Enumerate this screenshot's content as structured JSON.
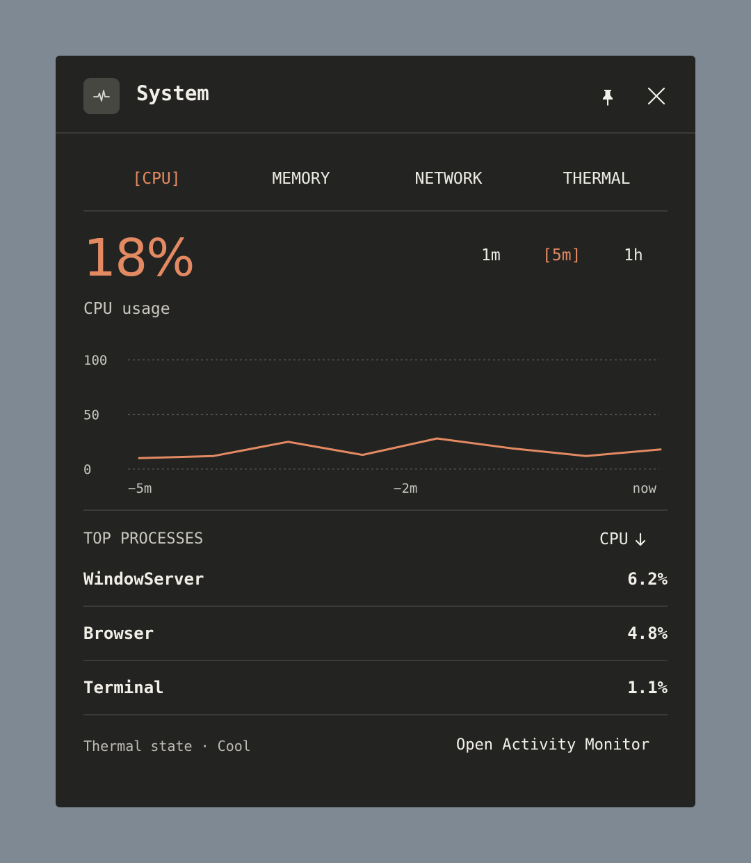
{
  "header": {
    "title": "System",
    "icon": "pulse-icon"
  },
  "tabs": [
    {
      "label": "[CPU]",
      "active": true
    },
    {
      "label": "MEMORY",
      "active": false
    },
    {
      "label": "NETWORK",
      "active": false
    },
    {
      "label": "THERMAL",
      "active": false
    }
  ],
  "metric": {
    "value": "18%",
    "label": "CPU usage"
  },
  "ranges": [
    {
      "label": "1m",
      "active": false
    },
    {
      "label": "[5m]",
      "active": true
    },
    {
      "label": "1h",
      "active": false
    }
  ],
  "chart_data": {
    "type": "line",
    "y_ticks": [
      "100",
      "50",
      "0"
    ],
    "x_ticks": [
      "−5m",
      "−2m",
      "now"
    ],
    "ylim": [
      0,
      100
    ],
    "grid": true,
    "series": [
      {
        "values": [
          10,
          12,
          25,
          13,
          28,
          19,
          12,
          18
        ]
      }
    ],
    "colors": {
      "line": "#e48a63",
      "grid": "#55554f"
    }
  },
  "processes": {
    "header": "TOP PROCESSES",
    "sort_label": "CPU",
    "rows": [
      {
        "name": "WindowServer",
        "value": "6.2%"
      },
      {
        "name": "Browser",
        "value": "4.8%"
      },
      {
        "name": "Terminal",
        "value": "1.1%"
      }
    ]
  },
  "footer": {
    "status": "Thermal state · Cool",
    "action": "Open Activity Monitor"
  },
  "colors": {
    "accent": "#e48a63",
    "panel": "#232321",
    "background": "#7f8994"
  }
}
